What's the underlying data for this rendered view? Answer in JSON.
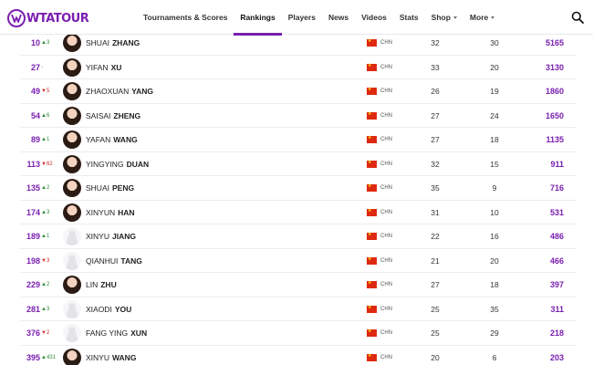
{
  "brand": {
    "logo_text": "WTATOUR"
  },
  "nav": {
    "items": [
      {
        "label": "Tournaments & Scores",
        "name": "nav-tournaments-scores",
        "active": false,
        "dropdown": false
      },
      {
        "label": "Rankings",
        "name": "nav-rankings",
        "active": true,
        "dropdown": false
      },
      {
        "label": "Players",
        "name": "nav-players",
        "active": false,
        "dropdown": false
      },
      {
        "label": "News",
        "name": "nav-news",
        "active": false,
        "dropdown": false
      },
      {
        "label": "Videos",
        "name": "nav-videos",
        "active": false,
        "dropdown": false
      },
      {
        "label": "Stats",
        "name": "nav-stats",
        "active": false,
        "dropdown": false
      },
      {
        "label": "Shop",
        "name": "nav-shop",
        "active": false,
        "dropdown": true
      },
      {
        "label": "More",
        "name": "nav-more",
        "active": false,
        "dropdown": true
      }
    ],
    "search_icon": "search-icon"
  },
  "colors": {
    "accent": "#7a1fb0",
    "up": "#2e8b3a",
    "down": "#cc2f2f"
  },
  "rankings": {
    "rows": [
      {
        "rank": "10",
        "move": "▲3",
        "dir": "up",
        "first": "SHUAI",
        "last": "ZHANG",
        "country": "CHN",
        "age": "32",
        "tournaments": "30",
        "points": "5165",
        "avatar": "photo"
      },
      {
        "rank": "27",
        "move": "-",
        "dir": "same",
        "first": "YIFAN",
        "last": "XU",
        "country": "CHN",
        "age": "33",
        "tournaments": "20",
        "points": "3130",
        "avatar": "photo"
      },
      {
        "rank": "49",
        "move": "▼5",
        "dir": "down",
        "first": "ZHAOXUAN",
        "last": "YANG",
        "country": "CHN",
        "age": "26",
        "tournaments": "19",
        "points": "1860",
        "avatar": "photo"
      },
      {
        "rank": "54",
        "move": "▲6",
        "dir": "up",
        "first": "SAISAI",
        "last": "ZHENG",
        "country": "CHN",
        "age": "27",
        "tournaments": "24",
        "points": "1650",
        "avatar": "photo"
      },
      {
        "rank": "89",
        "move": "▲1",
        "dir": "up",
        "first": "YAFAN",
        "last": "WANG",
        "country": "CHN",
        "age": "27",
        "tournaments": "18",
        "points": "1135",
        "avatar": "photo"
      },
      {
        "rank": "113",
        "move": "▼62",
        "dir": "down",
        "first": "YINGYING",
        "last": "DUAN",
        "country": "CHN",
        "age": "32",
        "tournaments": "15",
        "points": "911",
        "avatar": "photo"
      },
      {
        "rank": "135",
        "move": "▲2",
        "dir": "up",
        "first": "SHUAI",
        "last": "PENG",
        "country": "CHN",
        "age": "35",
        "tournaments": "9",
        "points": "716",
        "avatar": "photo"
      },
      {
        "rank": "174",
        "move": "▲3",
        "dir": "up",
        "first": "XINYUN",
        "last": "HAN",
        "country": "CHN",
        "age": "31",
        "tournaments": "10",
        "points": "531",
        "avatar": "photo"
      },
      {
        "rank": "189",
        "move": "▲1",
        "dir": "up",
        "first": "XINYU",
        "last": "JIANG",
        "country": "CHN",
        "age": "22",
        "tournaments": "16",
        "points": "486",
        "avatar": "silhouette"
      },
      {
        "rank": "198",
        "move": "▼3",
        "dir": "down",
        "first": "QIANHUI",
        "last": "TANG",
        "country": "CHN",
        "age": "21",
        "tournaments": "20",
        "points": "466",
        "avatar": "silhouette"
      },
      {
        "rank": "229",
        "move": "▲2",
        "dir": "up",
        "first": "LIN",
        "last": "ZHU",
        "country": "CHN",
        "age": "27",
        "tournaments": "18",
        "points": "397",
        "avatar": "photo"
      },
      {
        "rank": "281",
        "move": "▲3",
        "dir": "up",
        "first": "XIAODI",
        "last": "YOU",
        "country": "CHN",
        "age": "25",
        "tournaments": "35",
        "points": "311",
        "avatar": "silhouette"
      },
      {
        "rank": "376",
        "move": "▼2",
        "dir": "down",
        "first": "FANG YING",
        "last": "XUN",
        "country": "CHN",
        "age": "25",
        "tournaments": "29",
        "points": "218",
        "avatar": "silhouette"
      },
      {
        "rank": "395",
        "move": "▲431",
        "dir": "up",
        "first": "XINYU",
        "last": "WANG",
        "country": "CHN",
        "age": "20",
        "tournaments": "6",
        "points": "203",
        "avatar": "photo"
      }
    ]
  }
}
